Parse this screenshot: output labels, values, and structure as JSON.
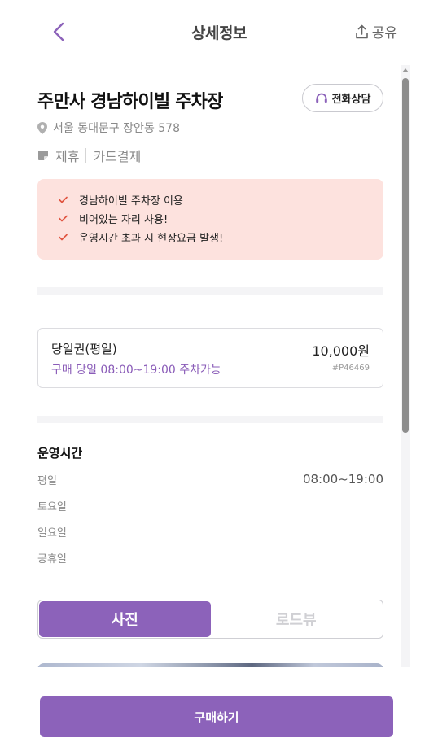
{
  "header": {
    "title": "상세정보",
    "share_label": "공유"
  },
  "lot": {
    "name": "주만사 경남하이빌 주차장",
    "phone_label": "전화상담",
    "address": "서울 동대문구 장안동 578",
    "tags": [
      "제휴",
      "카드결제"
    ]
  },
  "notices": [
    "경남하이빌 주차장 이용",
    "비어있는 자리 사용!",
    "운영시간 초과 시 현장요금 발생!"
  ],
  "ticket": {
    "name": "당일권(평일)",
    "price": "10,000원",
    "description": "구매 당일 08:00~19:00 주차가능",
    "code": "#P46469"
  },
  "hours": {
    "title": "운영시간",
    "rows": [
      {
        "day": "평일",
        "time": "08:00~19:00"
      },
      {
        "day": "토요일",
        "time": ""
      },
      {
        "day": "일요일",
        "time": ""
      },
      {
        "day": "공휴일",
        "time": ""
      }
    ]
  },
  "tabs": {
    "photo": "사진",
    "roadview": "로드뷰",
    "selected": "사진"
  },
  "purchase": {
    "button_label": "구매하기"
  },
  "colors": {
    "accent": "#8c62ba",
    "notice_bg": "#fde2de",
    "check": "#e0533f"
  }
}
